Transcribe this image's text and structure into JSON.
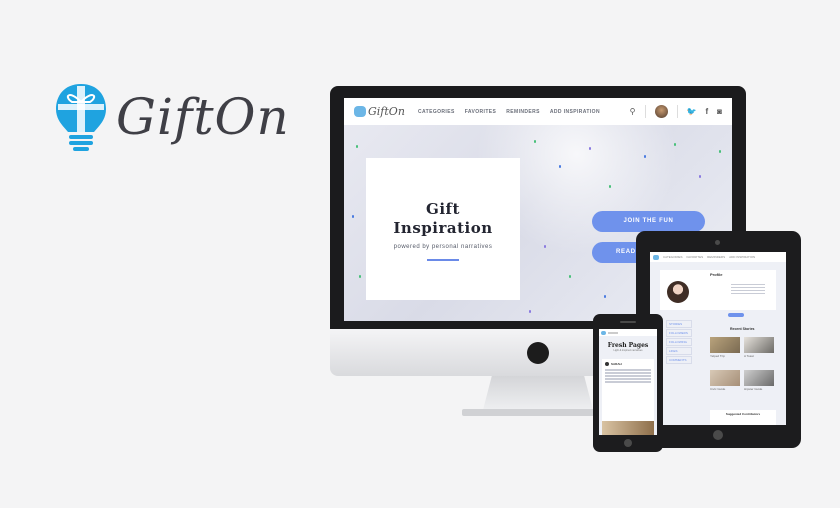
{
  "brand": {
    "name": "GiftOn",
    "accent": "#1fa3e0"
  },
  "desktop": {
    "nav": {
      "logo_text": "GiftOn",
      "links": [
        "CATEGORIES",
        "FAVORITES",
        "REMINDERS",
        "ADD INSPIRATION"
      ],
      "icons": [
        "search-icon",
        "twitter-icon",
        "facebook-icon",
        "instagram-icon"
      ]
    },
    "hero": {
      "title_line1": "Gift",
      "title_line2": "Inspiration",
      "subtitle": "powered by personal narratives",
      "join_button": "JOIN THE FUN",
      "read_button": "READ"
    },
    "accent": "#6f92ec"
  },
  "tablet": {
    "nav_links": [
      "CATEGORIES",
      "FAVORITES",
      "REMINDERS",
      "ADD INSPIRATION"
    ],
    "profile_heading": "Profile",
    "recent_stories": "Recent Stories",
    "stories": [
      "Yelped Trip",
      "A Toast",
      "Civic Guide",
      "Hipster Guide"
    ],
    "suggested": "Suggested Contributors",
    "profile_links": [
      "STORIES",
      "FOLLOWERS",
      "FOLLOWING",
      "LIKES",
      "COMMENTS"
    ]
  },
  "phone": {
    "title": "Fresh Pages",
    "subtitle": "Light & Inspired narratives",
    "author": "SARAH"
  }
}
